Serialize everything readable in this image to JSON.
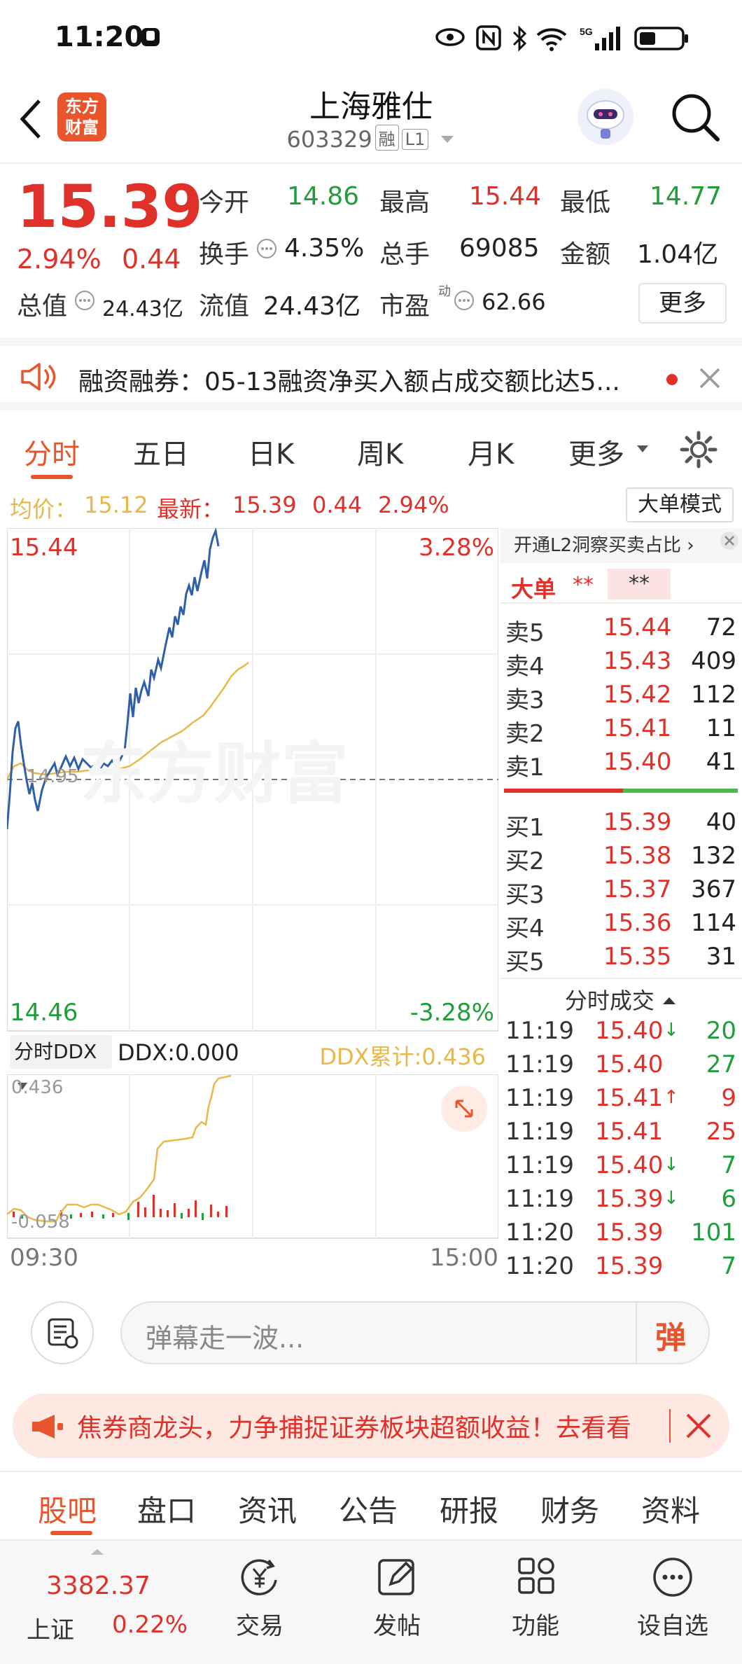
{
  "status": {
    "time": "11:20"
  },
  "header": {
    "back_icon": "chevron-left-icon",
    "logo_text_1": "东方",
    "logo_text_2": "财富",
    "title": "上海雅仕",
    "code": "603329",
    "tag_rong": "融",
    "tag_level": "L1",
    "search_icon": "search-icon"
  },
  "quote": {
    "price": "15.39",
    "change_pct": "2.94%",
    "change": "0.44",
    "open_label": "今开",
    "open": "14.86",
    "high_label": "最高",
    "high": "15.44",
    "low_label": "最低",
    "low": "14.77",
    "turnover_label": "换手",
    "turnover": "4.35%",
    "volume_label": "总手",
    "volume": "69085",
    "amount_label": "金额",
    "amount": "1.04亿",
    "mktcap_label": "总值",
    "mktcap": "24.43亿",
    "float_label": "流值",
    "float": "24.43亿",
    "pe_label": "市盈",
    "pe_sup": "动",
    "pe": "62.66",
    "more_button": "更多"
  },
  "notice": {
    "text": "融资融券：05-13融资净买入额占成交额比达5..."
  },
  "chart_tabs": [
    "分时",
    "五日",
    "日K",
    "周K",
    "月K",
    "更多"
  ],
  "info_line": {
    "avg_label": "均价：",
    "avg": "15.12",
    "latest_label": "最新：",
    "latest": "15.39",
    "chg": "0.44",
    "pct": "2.94%",
    "mode_button": "大单模式"
  },
  "chart": {
    "top_price": "15.44",
    "top_pct": "3.28%",
    "bottom_price": "14.46",
    "bottom_pct": "-3.28%",
    "mid_label": "14.95",
    "watermark": "东方财富",
    "price_color": "#2e5fa8",
    "avg_color": "#e8b84a"
  },
  "ddx": {
    "selector": "分时DDX",
    "ddx_label": "DDX:0.000",
    "ddx_cum": "DDX累计:0.436",
    "top_val": "0.436",
    "bottom_val": "-0.058",
    "time_start": "09:30",
    "time_end": "15:00"
  },
  "book": {
    "l2_promo": "开通L2洞察买卖占比",
    "big_label": "大单",
    "big_v1": "**",
    "big_v2": "**",
    "asks": [
      {
        "label": "卖5",
        "price": "15.44",
        "vol": "72"
      },
      {
        "label": "卖4",
        "price": "15.43",
        "vol": "409"
      },
      {
        "label": "卖3",
        "price": "15.42",
        "vol": "112"
      },
      {
        "label": "卖2",
        "price": "15.41",
        "vol": "11"
      },
      {
        "label": "卖1",
        "price": "15.40",
        "vol": "41"
      }
    ],
    "bids": [
      {
        "label": "买1",
        "price": "15.39",
        "vol": "40"
      },
      {
        "label": "买2",
        "price": "15.38",
        "vol": "132"
      },
      {
        "label": "买3",
        "price": "15.37",
        "vol": "367"
      },
      {
        "label": "买4",
        "price": "15.36",
        "vol": "114"
      },
      {
        "label": "买5",
        "price": "15.35",
        "vol": "31"
      }
    ],
    "ticks_title": "分时成交",
    "ticks": [
      {
        "time": "11:19",
        "price": "15.40",
        "dir": "↓",
        "vol": "20",
        "pc": "red",
        "vc": "green"
      },
      {
        "time": "11:19",
        "price": "15.40",
        "dir": "",
        "vol": "27",
        "pc": "red",
        "vc": "green"
      },
      {
        "time": "11:19",
        "price": "15.41",
        "dir": "↑",
        "vol": "9",
        "pc": "red",
        "vc": "red"
      },
      {
        "time": "11:19",
        "price": "15.41",
        "dir": "",
        "vol": "25",
        "pc": "red",
        "vc": "red"
      },
      {
        "time": "11:19",
        "price": "15.40",
        "dir": "↓",
        "vol": "7",
        "pc": "red",
        "vc": "green"
      },
      {
        "time": "11:19",
        "price": "15.39",
        "dir": "↓",
        "vol": "6",
        "pc": "red",
        "vc": "green"
      },
      {
        "time": "11:20",
        "price": "15.39",
        "dir": "",
        "vol": "101",
        "pc": "red",
        "vc": "green"
      },
      {
        "time": "11:20",
        "price": "15.39",
        "dir": "",
        "vol": "7",
        "pc": "red",
        "vc": "green"
      }
    ]
  },
  "danmu": {
    "placeholder": "弹幕走一波...",
    "button": "弹"
  },
  "ad": {
    "text": "焦券商龙头，力争捕捉证券板块超额收益！去看看"
  },
  "bottom_tabs": [
    "股吧",
    "盘口",
    "资讯",
    "公告",
    "研报",
    "财务",
    "资料"
  ],
  "navbar": {
    "index_value": "3382.37",
    "index_name": "上证",
    "index_pct": "0.22%",
    "items": [
      {
        "label": "交易",
        "icon": "yen-cycle-icon"
      },
      {
        "label": "发帖",
        "icon": "edit-icon"
      },
      {
        "label": "功能",
        "icon": "grid-icon"
      },
      {
        "label": "设自选",
        "icon": "more-circle-icon"
      }
    ]
  },
  "colors": {
    "up": "#e0302a",
    "down": "#1f9e3a",
    "accent": "#e8542c"
  }
}
